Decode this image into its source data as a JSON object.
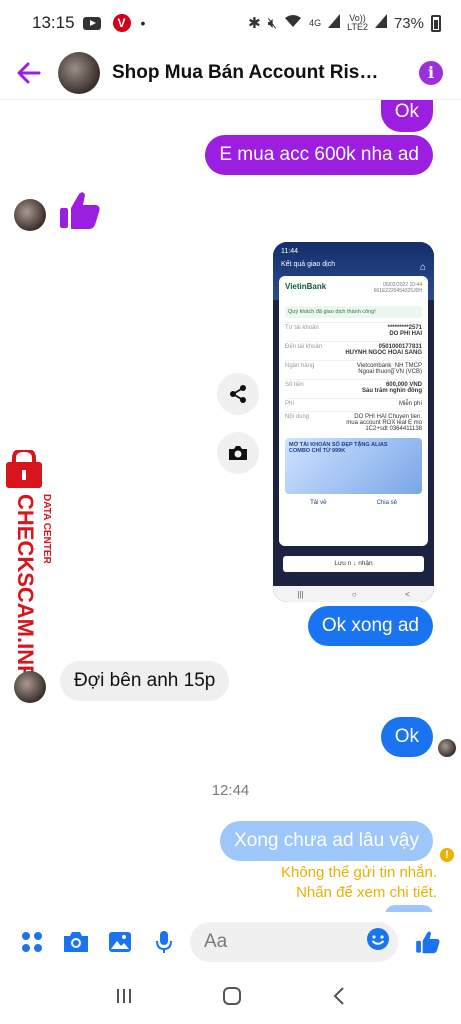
{
  "status_bar": {
    "time": "13:15",
    "network": "4G",
    "volte_top": "Vo))",
    "volte_bottom": "LTE2",
    "battery": "73%"
  },
  "header": {
    "title": "Shop Mua Bán Account Rise..."
  },
  "messages": [
    {
      "text": "Ok"
    },
    {
      "text": "E mua acc 600k nha ad"
    },
    {
      "text": "Ok xong ad"
    },
    {
      "text": "Đợi bên anh 15p"
    },
    {
      "text": "Ok"
    },
    {
      "text": "Xong chưa ad lâu vậy"
    }
  ],
  "timestamp": "12:44",
  "error": {
    "line1": "Không thể gửi tin nhắn.",
    "line2": "Nhấn để xem chi tiết."
  },
  "receipt": {
    "status_time": "11:44",
    "title": "Kết quả giao dịch",
    "bank": "VietinBank",
    "date": "05/02/2022 10:44",
    "ref": "661E2220454325J0H",
    "note": "Quý khách đã giao dịch thành công!",
    "rows": [
      {
        "label": "Từ tài khoản",
        "value": "*********2571\nDO PHI HAI"
      },
      {
        "label": "Đến tài khoản",
        "value": "0501000177831\nHUYNH NGOC HOAI SANG"
      },
      {
        "label": "Ngân hàng",
        "value": "Vietcombank_NH TMCP\nNgoai thuong VN (VCB)"
      },
      {
        "label": "Số tiền",
        "value": "600,000 VND\nSáu trăm nghìn đồng"
      },
      {
        "label": "Phí",
        "value": "Miễn phí"
      },
      {
        "label": "Nội dung",
        "value": "DO PHI HAI Chuyen tien.\nmua account ROX leal E mo\n1C2+sdt 0364411138"
      }
    ],
    "promo_line1": "MỞ TÀI KHOẢN SỐ ĐẸP TẶNG ALIAS",
    "promo_line2": "COMBO CHỈ TỪ 999K",
    "share": "Tải về",
    "share2": "Chia sẻ",
    "save": "Lưu n ↓ nhận"
  },
  "watermark": {
    "line1": "DATA CENTER",
    "line2": "CHECKSCAM.INFO"
  },
  "composer": {
    "placeholder": "Aa"
  },
  "colors": {
    "accent": "#9c1ee0",
    "sent_blue": "#1a74f2",
    "failed_blue": "#9dc7fb",
    "warning": "#e9b100",
    "watermark_red": "#d8141c"
  }
}
